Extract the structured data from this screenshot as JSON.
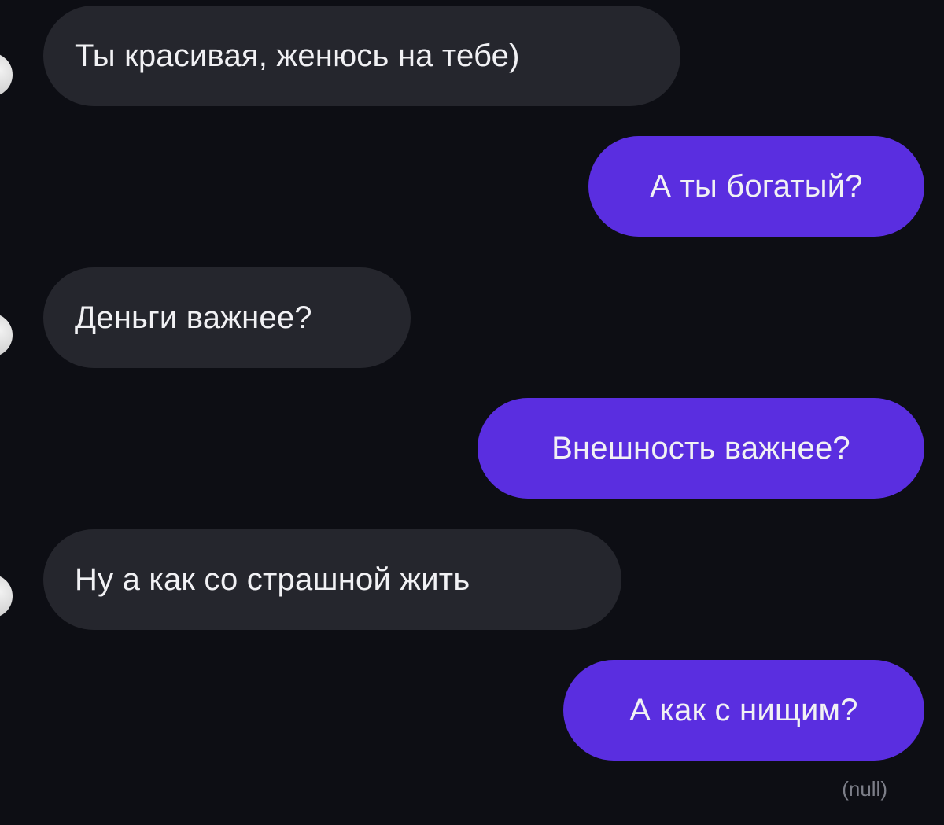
{
  "messages": [
    {
      "direction": "incoming",
      "text": "Ты красивая, женюсь на тебе)"
    },
    {
      "direction": "outgoing",
      "text": "А ты богатый?"
    },
    {
      "direction": "incoming",
      "text": "Деньги важнее?"
    },
    {
      "direction": "outgoing",
      "text": "Внешность важнее?"
    },
    {
      "direction": "incoming",
      "text": "Ну а как со страшной жить"
    },
    {
      "direction": "outgoing",
      "text": "А как с нищим?"
    }
  ],
  "status_text": "(null)",
  "colors": {
    "background": "#0d0e14",
    "incoming_bubble": "#25262d",
    "outgoing_bubble": "#5a2ee0",
    "message_text": "#f1f1f4",
    "status_text": "#7c7e88"
  }
}
